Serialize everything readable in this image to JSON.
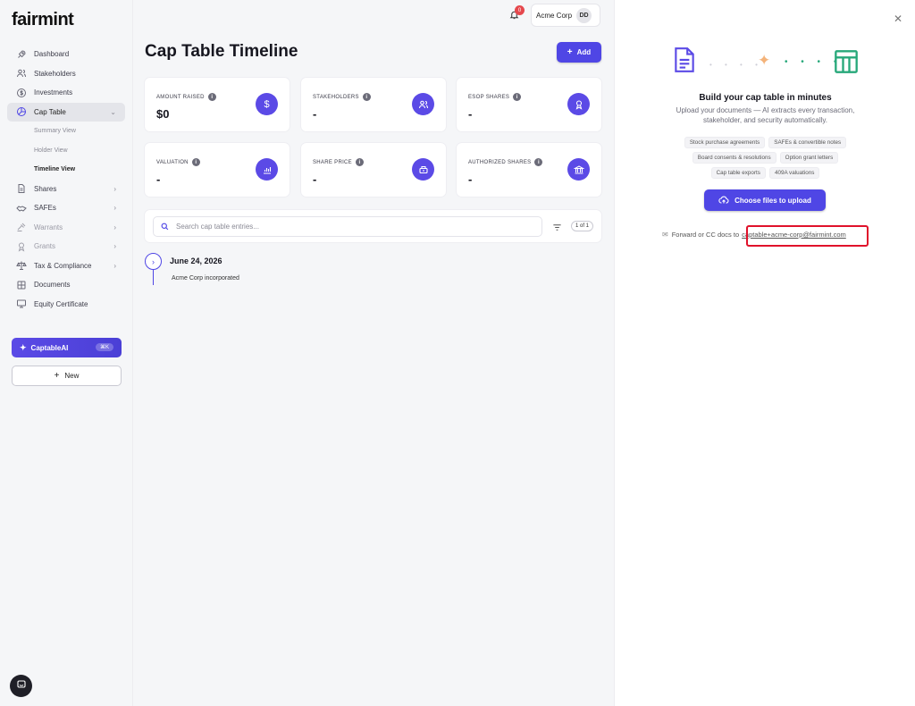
{
  "brand": {
    "logo_text": "fairmint",
    "logo_accent": "#7b3fe4"
  },
  "sidebar": {
    "items": [
      {
        "label": "Dashboard",
        "icon": "rocket-icon"
      },
      {
        "label": "Stakeholders",
        "icon": "users-icon"
      },
      {
        "label": "Investments",
        "icon": "dollar-circle-icon"
      },
      {
        "label": "Cap Table",
        "icon": "pie-icon"
      },
      {
        "label": "Shares",
        "icon": "document-icon"
      },
      {
        "label": "SAFEs",
        "icon": "handshake-icon"
      },
      {
        "label": "Warrants",
        "icon": "gavel-icon"
      },
      {
        "label": "Grants",
        "icon": "badge-icon"
      },
      {
        "label": "Tax & Compliance",
        "icon": "scale-icon"
      },
      {
        "label": "Documents",
        "icon": "grid-icon"
      },
      {
        "label": "Equity Certificate",
        "icon": "certificate-icon"
      }
    ],
    "cap_table_sub": [
      {
        "label": "Summary View"
      },
      {
        "label": "Holder View"
      },
      {
        "label": "Timeline View"
      }
    ],
    "captable_ai": {
      "label": "CaptableAI",
      "shortcut": "⌘K"
    },
    "new_button": "New"
  },
  "header": {
    "notification_count": "0",
    "org_name": "Acme Corp",
    "avatar_initials": "DD"
  },
  "main": {
    "title": "Cap Table Timeline",
    "add_label": "Add",
    "cards": [
      {
        "label": "AMOUNT RAISED",
        "value": "$0",
        "icon": "dollar-icon"
      },
      {
        "label": "STAKEHOLDERS",
        "value": "-",
        "icon": "people-icon"
      },
      {
        "label": "ESOP SHARES",
        "value": "-",
        "icon": "award-icon"
      },
      {
        "label": "VALUATION",
        "value": "-",
        "icon": "bar-chart-icon"
      },
      {
        "label": "SHARE PRICE",
        "value": "-",
        "icon": "price-tag-icon"
      },
      {
        "label": "AUTHORIZED SHARES",
        "value": "-",
        "icon": "bank-icon"
      }
    ],
    "search_placeholder": "Search cap table entries...",
    "page_count": "1 of 1",
    "timeline": [
      {
        "date": "June 24, 2026",
        "event": "Acme Corp incorporated"
      }
    ]
  },
  "panel": {
    "title": "Build your cap table in minutes",
    "description": "Upload your documents — AI extracts every transaction, stakeholder, and security automatically.",
    "chips": [
      "Stock purchase agreements",
      "SAFEs & convertible notes",
      "Board consents & resolutions",
      "Option grant letters",
      "Cap table exports",
      "409A valuations"
    ],
    "upload_label": "Choose files to upload",
    "forward_text": "Forward or CC docs to",
    "forward_email": "captable+acme-corp@fairmint.com",
    "colors": {
      "accent": "#4f46e5",
      "highlight": "#e0122b",
      "green": "#27a87a"
    }
  }
}
